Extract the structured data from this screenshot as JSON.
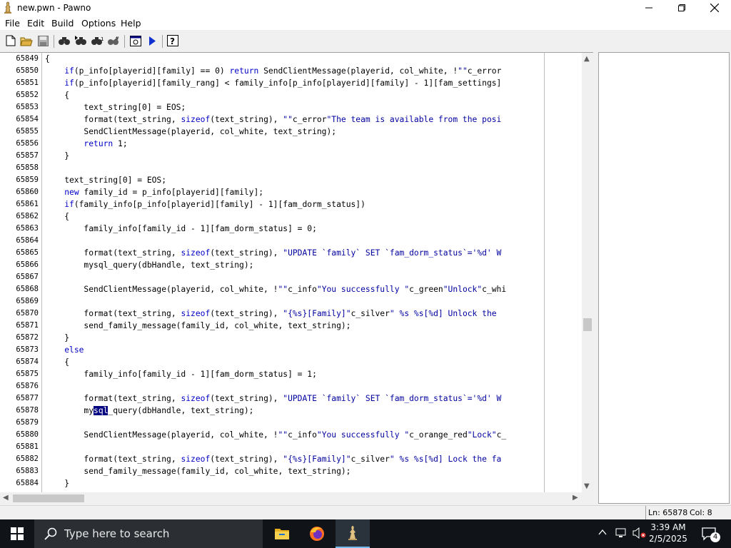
{
  "window": {
    "title": "new.pwn - Pawno",
    "minimize_icon": "minimize-icon",
    "maximize_icon": "maximize-icon",
    "close_icon": "close-icon"
  },
  "menu": [
    "File",
    "Edit",
    "Build",
    "Options",
    "Help"
  ],
  "toolbar": {
    "icons": [
      "new-file-icon",
      "open-folder-icon",
      "save-icon",
      "find-icon",
      "find-next-icon",
      "replace-icon",
      "goto-line-icon",
      "compile-options-icon",
      "run-icon",
      "help-icon"
    ]
  },
  "editor": {
    "first_line": 65849,
    "lines": [
      "{",
      "    if(p_info[playerid][family] == 0) return SendClientMessage(playerid, col_white, !\"\"c_error",
      "    if(p_info[playerid][family_rang] < family_info[p_info[playerid][family] - 1][fam_settings]",
      "    {",
      "        text_string[0] = EOS;",
      "        format(text_string, sizeof(text_string), \"\"c_error\"The team is available from the posi",
      "        SendClientMessage(playerid, col_white, text_string);",
      "        return 1;",
      "    }",
      "",
      "    text_string[0] = EOS;",
      "    new family_id = p_info[playerid][family];",
      "    if(family_info[p_info[playerid][family] - 1][fam_dorm_status])",
      "    {",
      "        family_info[family_id - 1][fam_dorm_status] = 0;",
      "",
      "        format(text_string, sizeof(text_string), \"UPDATE `family` SET `fam_dorm_status`='%d' W",
      "        mysql_query(dbHandle, text_string);",
      "",
      "        SendClientMessage(playerid, col_white, !\"\"c_info\"You successfully \"c_green\"Unlock\"c_whi",
      "",
      "        format(text_string, sizeof(text_string), \"{%s}[Family]\"c_silver\" %s %s[%d] Unlock the ",
      "        send_family_message(family_id, col_white, text_string);",
      "    }",
      "    else",
      "    {",
      "        family_info[family_id - 1][fam_dorm_status] = 1;",
      "",
      "        format(text_string, sizeof(text_string), \"UPDATE `family` SET `fam_dorm_status`='%d' W",
      "        mysql_query(dbHandle, text_string);",
      "",
      "        SendClientMessage(playerid, col_white, !\"\"c_info\"You successfully \"c_orange_red\"Lock\"c_",
      "",
      "        format(text_string, sizeof(text_string), \"{%s}[Family]\"c_silver\" %s %s[%d] Lock the fa",
      "        send_family_message(family_id, col_white, text_string);",
      "    }"
    ],
    "line_numbers": [
      "65849",
      "65850",
      "65851",
      "65852",
      "65853",
      "65854",
      "65855",
      "65856",
      "65857",
      "65858",
      "65859",
      "65860",
      "65861",
      "65862",
      "65863",
      "65864",
      "65865",
      "65866",
      "65867",
      "65868",
      "65869",
      "65870",
      "65871",
      "65872",
      "65873",
      "65874",
      "65875",
      "65876",
      "65877",
      "65878",
      "65879",
      "65880",
      "65881",
      "65882",
      "65883",
      "65884"
    ],
    "selection": {
      "line_index": 29,
      "text": "sql"
    }
  },
  "status": {
    "position": "Ln: 65878",
    "column": "Col: 8"
  },
  "taskbar": {
    "search_placeholder": "Type here to search",
    "time": "3:39 AM",
    "date": "2/5/2025",
    "notification_count": "4"
  },
  "colors": {
    "keyword": "#0000c8",
    "selection": "#000080",
    "taskbar": "#101418"
  }
}
